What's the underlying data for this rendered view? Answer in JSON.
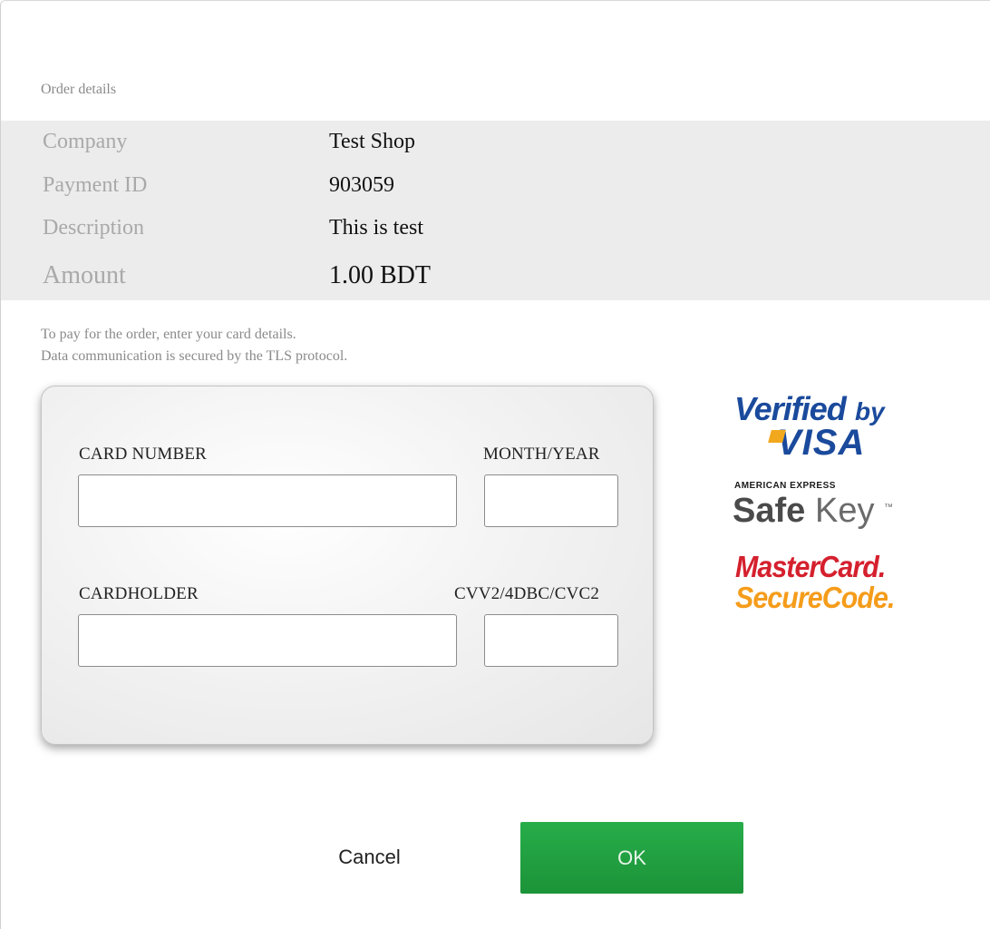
{
  "order": {
    "title": "Order details",
    "rows": [
      {
        "label": "Company",
        "value": "Test Shop"
      },
      {
        "label": "Payment ID",
        "value": "903059"
      },
      {
        "label": "Description",
        "value": "This is test"
      },
      {
        "label": "Amount",
        "value": "1.00 BDT"
      }
    ]
  },
  "notice": {
    "line1": "To pay for the order, enter your card details.",
    "line2": "Data communication is secured by the TLS protocol."
  },
  "card": {
    "card_number_label": "CARD NUMBER",
    "card_number_value": "",
    "month_year_label": "MONTH/YEAR",
    "month_year_value": "",
    "cardholder_label": "CARDHOLDER",
    "cardholder_value": "",
    "cvv_label": "CVV2/4DBC/CVC2",
    "cvv_value": ""
  },
  "logos": {
    "visa_line1": "Verified",
    "visa_by": "by",
    "visa_line2": "VISA",
    "amex_small": "AMERICAN EXPRESS",
    "amex_safe": "Safe",
    "amex_key": "Key",
    "amex_tm": "™",
    "mc_line1": "MasterCard.",
    "mc_line2": "SecureCode."
  },
  "buttons": {
    "cancel": "Cancel",
    "ok": "OK"
  },
  "colors": {
    "ok_button": "#22a143",
    "visa_blue": "#1a4a9c",
    "visa_gold": "#f2a81d",
    "mc_red": "#d5202e",
    "mc_orange": "#f59c1a"
  }
}
